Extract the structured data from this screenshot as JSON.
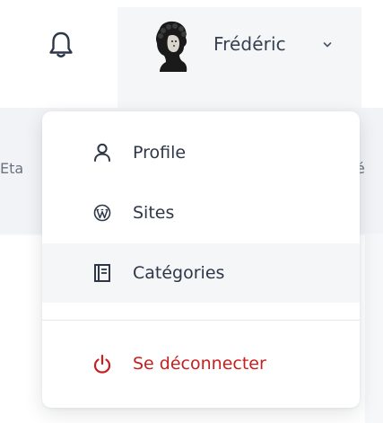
{
  "header": {
    "bell_icon": "bell-icon",
    "user": {
      "name": "Frédéric",
      "avatar_icon": "avatar-portrait",
      "chevron_icon": "chevron-down-icon"
    }
  },
  "background": {
    "left_text": "Eta",
    "right_text": "é"
  },
  "menu": {
    "items": [
      {
        "label": "Profile",
        "icon": "user-icon"
      },
      {
        "label": "Sites",
        "icon": "wordpress-icon"
      },
      {
        "label": "Catégories",
        "icon": "notebook-icon"
      }
    ],
    "logout": {
      "label": "Se déconnecter",
      "icon": "power-icon",
      "color": "#c81e1e"
    }
  },
  "colors": {
    "accent_danger": "#c81e1e",
    "hover_bg": "#f4f6f8"
  }
}
